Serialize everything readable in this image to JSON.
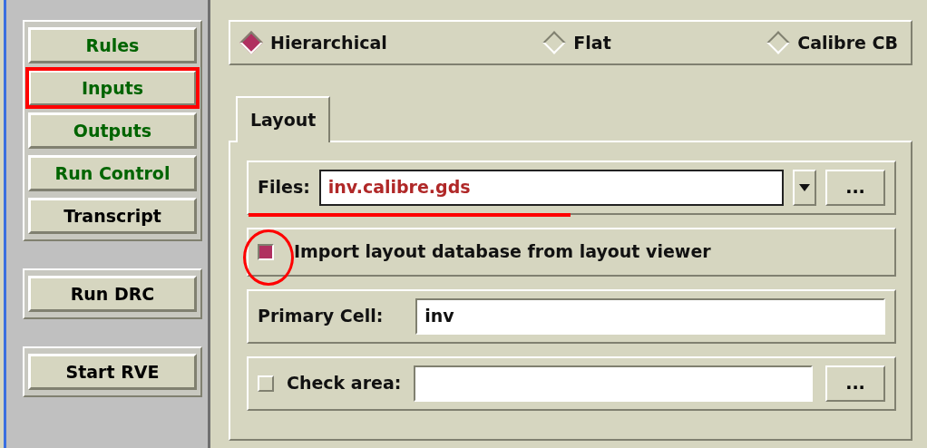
{
  "sidebar": {
    "groups": [
      {
        "items": [
          {
            "label": "Rules",
            "color": "#006400",
            "selected": false
          },
          {
            "label": "Inputs",
            "color": "#006400",
            "selected": true
          },
          {
            "label": "Outputs",
            "color": "#006400",
            "selected": false
          },
          {
            "label": "Run Control",
            "color": "#006400",
            "selected": false
          },
          {
            "label": "Transcript",
            "color": "#000000",
            "selected": false
          }
        ]
      },
      {
        "items": [
          {
            "label": "Run DRC",
            "color": "#000000",
            "selected": false
          }
        ]
      },
      {
        "items": [
          {
            "label": "Start RVE",
            "color": "#000000",
            "selected": false
          }
        ]
      }
    ]
  },
  "mode": [
    {
      "label": "Hierarchical",
      "selected": true
    },
    {
      "label": "Flat",
      "selected": false
    },
    {
      "label": "Calibre CB",
      "selected": false
    }
  ],
  "tabs": [
    {
      "label": "Layout",
      "selected": true
    }
  ],
  "files": {
    "label": "Files:",
    "value": "inv.calibre.gds",
    "browse": "..."
  },
  "import_option": {
    "label": "Import layout database from layout viewer",
    "checked": true
  },
  "primary_cell": {
    "label": "Primary Cell:",
    "value": "inv"
  },
  "check_area": {
    "label": "Check area:",
    "checked": false,
    "browse": "..."
  }
}
